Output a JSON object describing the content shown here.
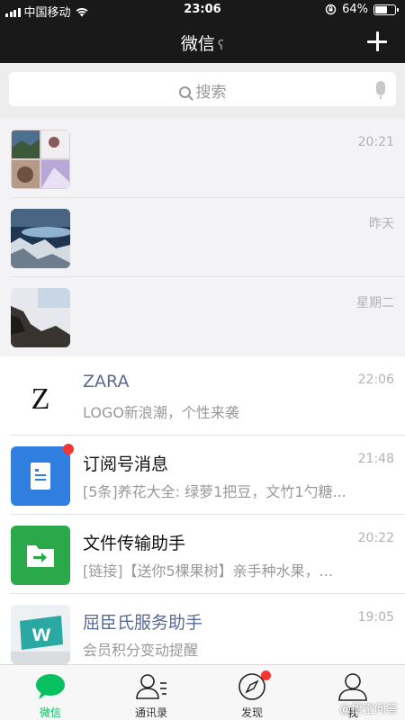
{
  "status_bar": {
    "carrier": "中国移动",
    "time": "23:06",
    "battery": "64%",
    "battery_level": 0.64
  },
  "nav": {
    "title": "微信",
    "ear_icon": "ear-icon",
    "add_icon": "plus-icon"
  },
  "search": {
    "placeholder": "搜索",
    "icon": "search-icon",
    "mic_icon": "microphone-icon"
  },
  "chats": [
    {
      "name": "",
      "time": "20:21",
      "preview": "",
      "pinned": true,
      "avatar": "photo-collage"
    },
    {
      "name": "",
      "time": "昨天",
      "preview": "",
      "pinned": true,
      "avatar": "lake-photo"
    },
    {
      "name": "",
      "time": "星期二",
      "preview": "",
      "pinned": true,
      "avatar": "blurred-photo"
    },
    {
      "name": "ZARA",
      "time": "22:06",
      "preview": "LOGO新浪潮，个性来袭",
      "avatar": "zara-logo"
    },
    {
      "name": "订阅号消息",
      "time": "21:48",
      "preview": "[5条]养花大全: 绿萝1把豆，文竹1勺糖...",
      "unread_dot": true,
      "avatar": "subscription-icon"
    },
    {
      "name": "文件传输助手",
      "time": "20:22",
      "preview": "[链接]【送你5棵果树】亲手种水果，...",
      "avatar": "file-transfer-icon"
    },
    {
      "name": "屈臣氏服务助手",
      "time": "19:05",
      "preview": "会员积分变动提醒",
      "avatar": "watsons-logo"
    }
  ],
  "tabs": [
    {
      "label": "微信",
      "icon": "chat-bubble-icon",
      "active": true
    },
    {
      "label": "通讯录",
      "icon": "contacts-icon"
    },
    {
      "label": "发现",
      "icon": "compass-icon",
      "badge_dot": true
    },
    {
      "label": "我",
      "icon": "person-icon"
    }
  ],
  "colors": {
    "accent": "#07c160",
    "nav_bg": "#191919",
    "unread": "#f43530"
  },
  "watermark": "@悟空问答"
}
